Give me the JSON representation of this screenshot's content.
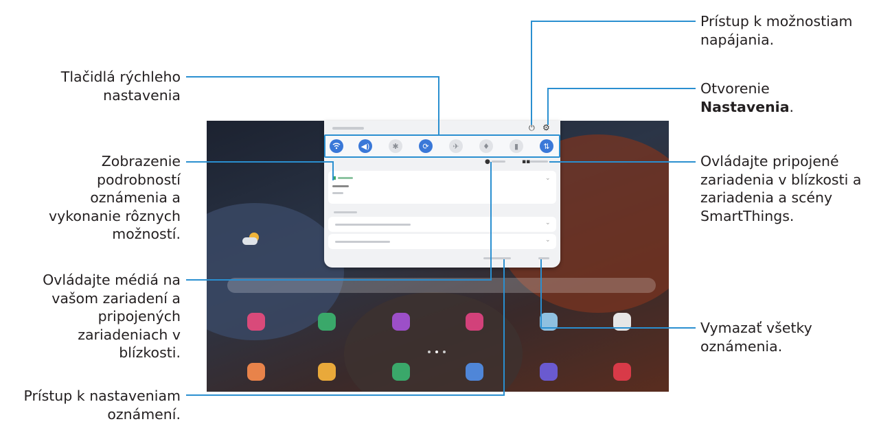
{
  "callouts": {
    "quick_settings": [
      "Tlačidlá rýchleho",
      "nastavenia"
    ],
    "notification_details": [
      "Zobrazenie",
      "podrobností",
      "oznámenia a",
      "vykonanie rôznych",
      "možností."
    ],
    "media": [
      "Ovládajte médiá na",
      "vašom zariadení a",
      "pripojených",
      "zariadeniach v",
      "blízkosti."
    ],
    "notification_settings": [
      "Prístup k nastaveniam",
      "oznámení."
    ],
    "power": [
      "Prístup k možnostiam",
      "napájania."
    ],
    "open_settings_prefix": "Otvorenie",
    "open_settings_bold": "Nastavenia",
    "open_settings_suffix": ".",
    "smartthings": [
      "Ovládajte pripojené",
      "zariadenia v blízkosti a",
      "zariadenia a scény",
      "SmartThings."
    ],
    "clear_all": [
      "Vymazať všetky",
      "oznámenia."
    ]
  },
  "icons": {
    "wifi": "wifi-icon",
    "sound": "sound-icon",
    "bluetooth": "bluetooth-icon",
    "autorotate": "autorotate-icon",
    "airplane": "airplane-icon",
    "flashlight": "flashlight-icon",
    "battery": "power-saving-icon",
    "data": "mobile-data-icon",
    "power": "power-icon",
    "gear": "gear-icon"
  },
  "colors": {
    "callout_line": "#2a8fd0",
    "quick_on": "#3a78d8"
  }
}
